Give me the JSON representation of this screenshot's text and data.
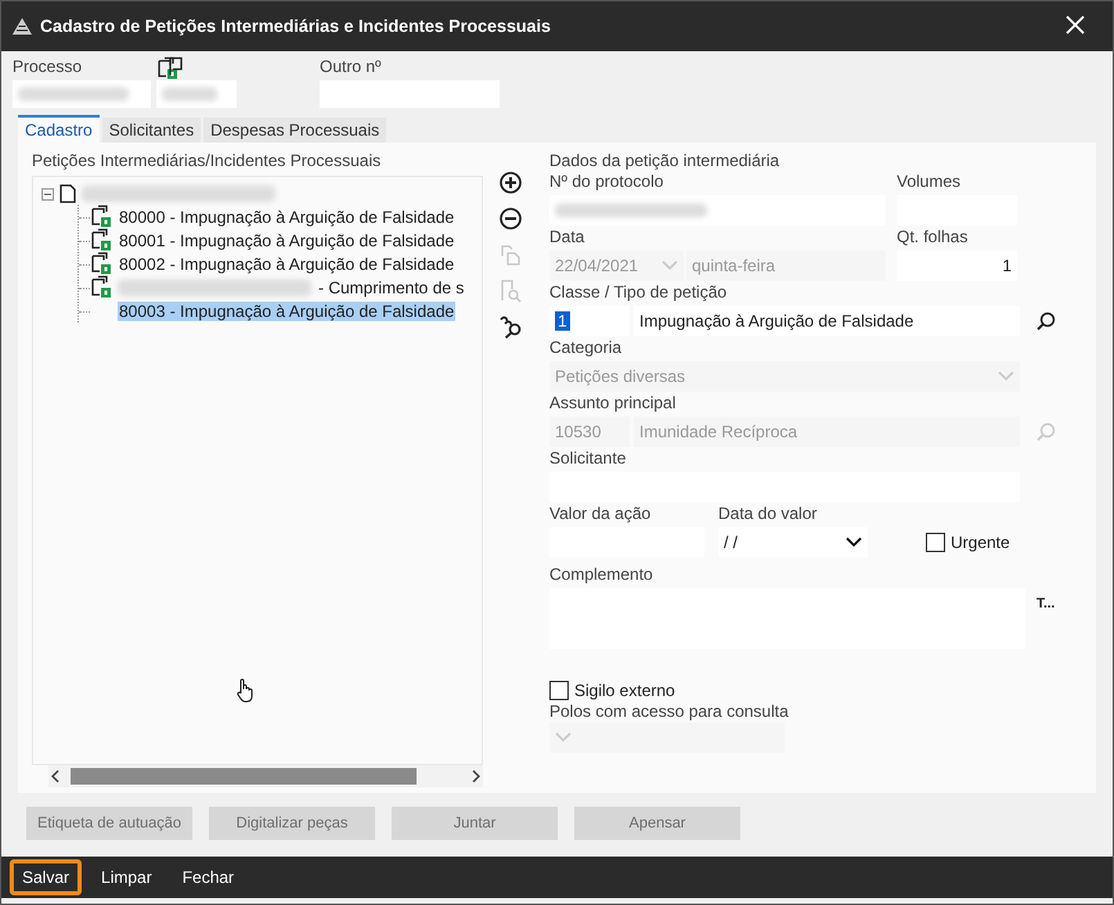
{
  "window": {
    "title": "Cadastro de Petições Intermediárias e Incidentes Processuais"
  },
  "header": {
    "processo_label": "Processo",
    "outro_label": "Outro nº"
  },
  "tabs": [
    {
      "label": "Cadastro",
      "selected": true
    },
    {
      "label": "Solicitantes",
      "selected": false
    },
    {
      "label": "Despesas Processuais",
      "selected": false
    }
  ],
  "tree_group": {
    "title": "Petições Intermediárias/Incidentes Processuais",
    "expanded": true,
    "children": [
      {
        "kind": "document",
        "redacted": false,
        "label": "80000 - Impugnação à Arguição de Falsidade",
        "selected": false
      },
      {
        "kind": "document",
        "redacted": false,
        "label": "80001 - Impugnação à Arguição de Falsidade",
        "selected": false
      },
      {
        "kind": "document",
        "redacted": false,
        "label": "80002 - Impugnação à Arguição de Falsidade",
        "selected": false
      },
      {
        "kind": "document",
        "redacted": true,
        "label": "- Cumprimento de s",
        "selected": false
      },
      {
        "kind": "plain",
        "redacted": false,
        "label": "80003 - Impugnação à Arguição de Falsidade",
        "selected": true
      }
    ]
  },
  "side_tools": [
    {
      "kind": "add",
      "disabled": false
    },
    {
      "kind": "remove",
      "disabled": false
    },
    {
      "kind": "copy",
      "disabled": true
    },
    {
      "kind": "preview",
      "disabled": true
    },
    {
      "kind": "link",
      "disabled": false
    }
  ],
  "form": {
    "title": "Dados da petição intermediária",
    "protocolo": {
      "label": "Nº do protocolo"
    },
    "volumes": {
      "label": "Volumes"
    },
    "data": {
      "label": "Data",
      "value": "22/04/2021",
      "weekday": "quinta-feira",
      "disabled": true
    },
    "folhas": {
      "label": "Qt. folhas",
      "value": "1"
    },
    "classe": {
      "label": "Classe / Tipo de petição",
      "code": "1",
      "value": "Impugnação à Arguição de Falsidade"
    },
    "categoria": {
      "label": "Categoria",
      "value": "Petições diversas",
      "disabled": true
    },
    "assunto": {
      "label": "Assunto principal",
      "code": "10530",
      "value": "Imunidade Recíproca",
      "disabled": true
    },
    "solicitante": {
      "label": "Solicitante"
    },
    "valor": {
      "label": "Valor da ação"
    },
    "data_valor": {
      "label": "Data do valor",
      "value": "/ /"
    },
    "urgente": {
      "label": "Urgente",
      "checked": false
    },
    "complemento": {
      "label": "Complemento",
      "format_button": "T..."
    },
    "sigilo": {
      "label": "Sigilo externo",
      "checked": false
    },
    "polos": {
      "label": "Polos com acesso para consulta",
      "disabled": true
    }
  },
  "action_buttons": [
    {
      "label": "Etiqueta de autuação",
      "disabled": true
    },
    {
      "label": "Digitalizar peças",
      "disabled": true
    },
    {
      "label": "Juntar",
      "disabled": true
    },
    {
      "label": "Apensar",
      "disabled": true
    }
  ],
  "footer_buttons": [
    {
      "label": "Salvar",
      "highlighted": true
    },
    {
      "label": "Limpar",
      "highlighted": false
    },
    {
      "label": "Fechar",
      "highlighted": false
    }
  ]
}
